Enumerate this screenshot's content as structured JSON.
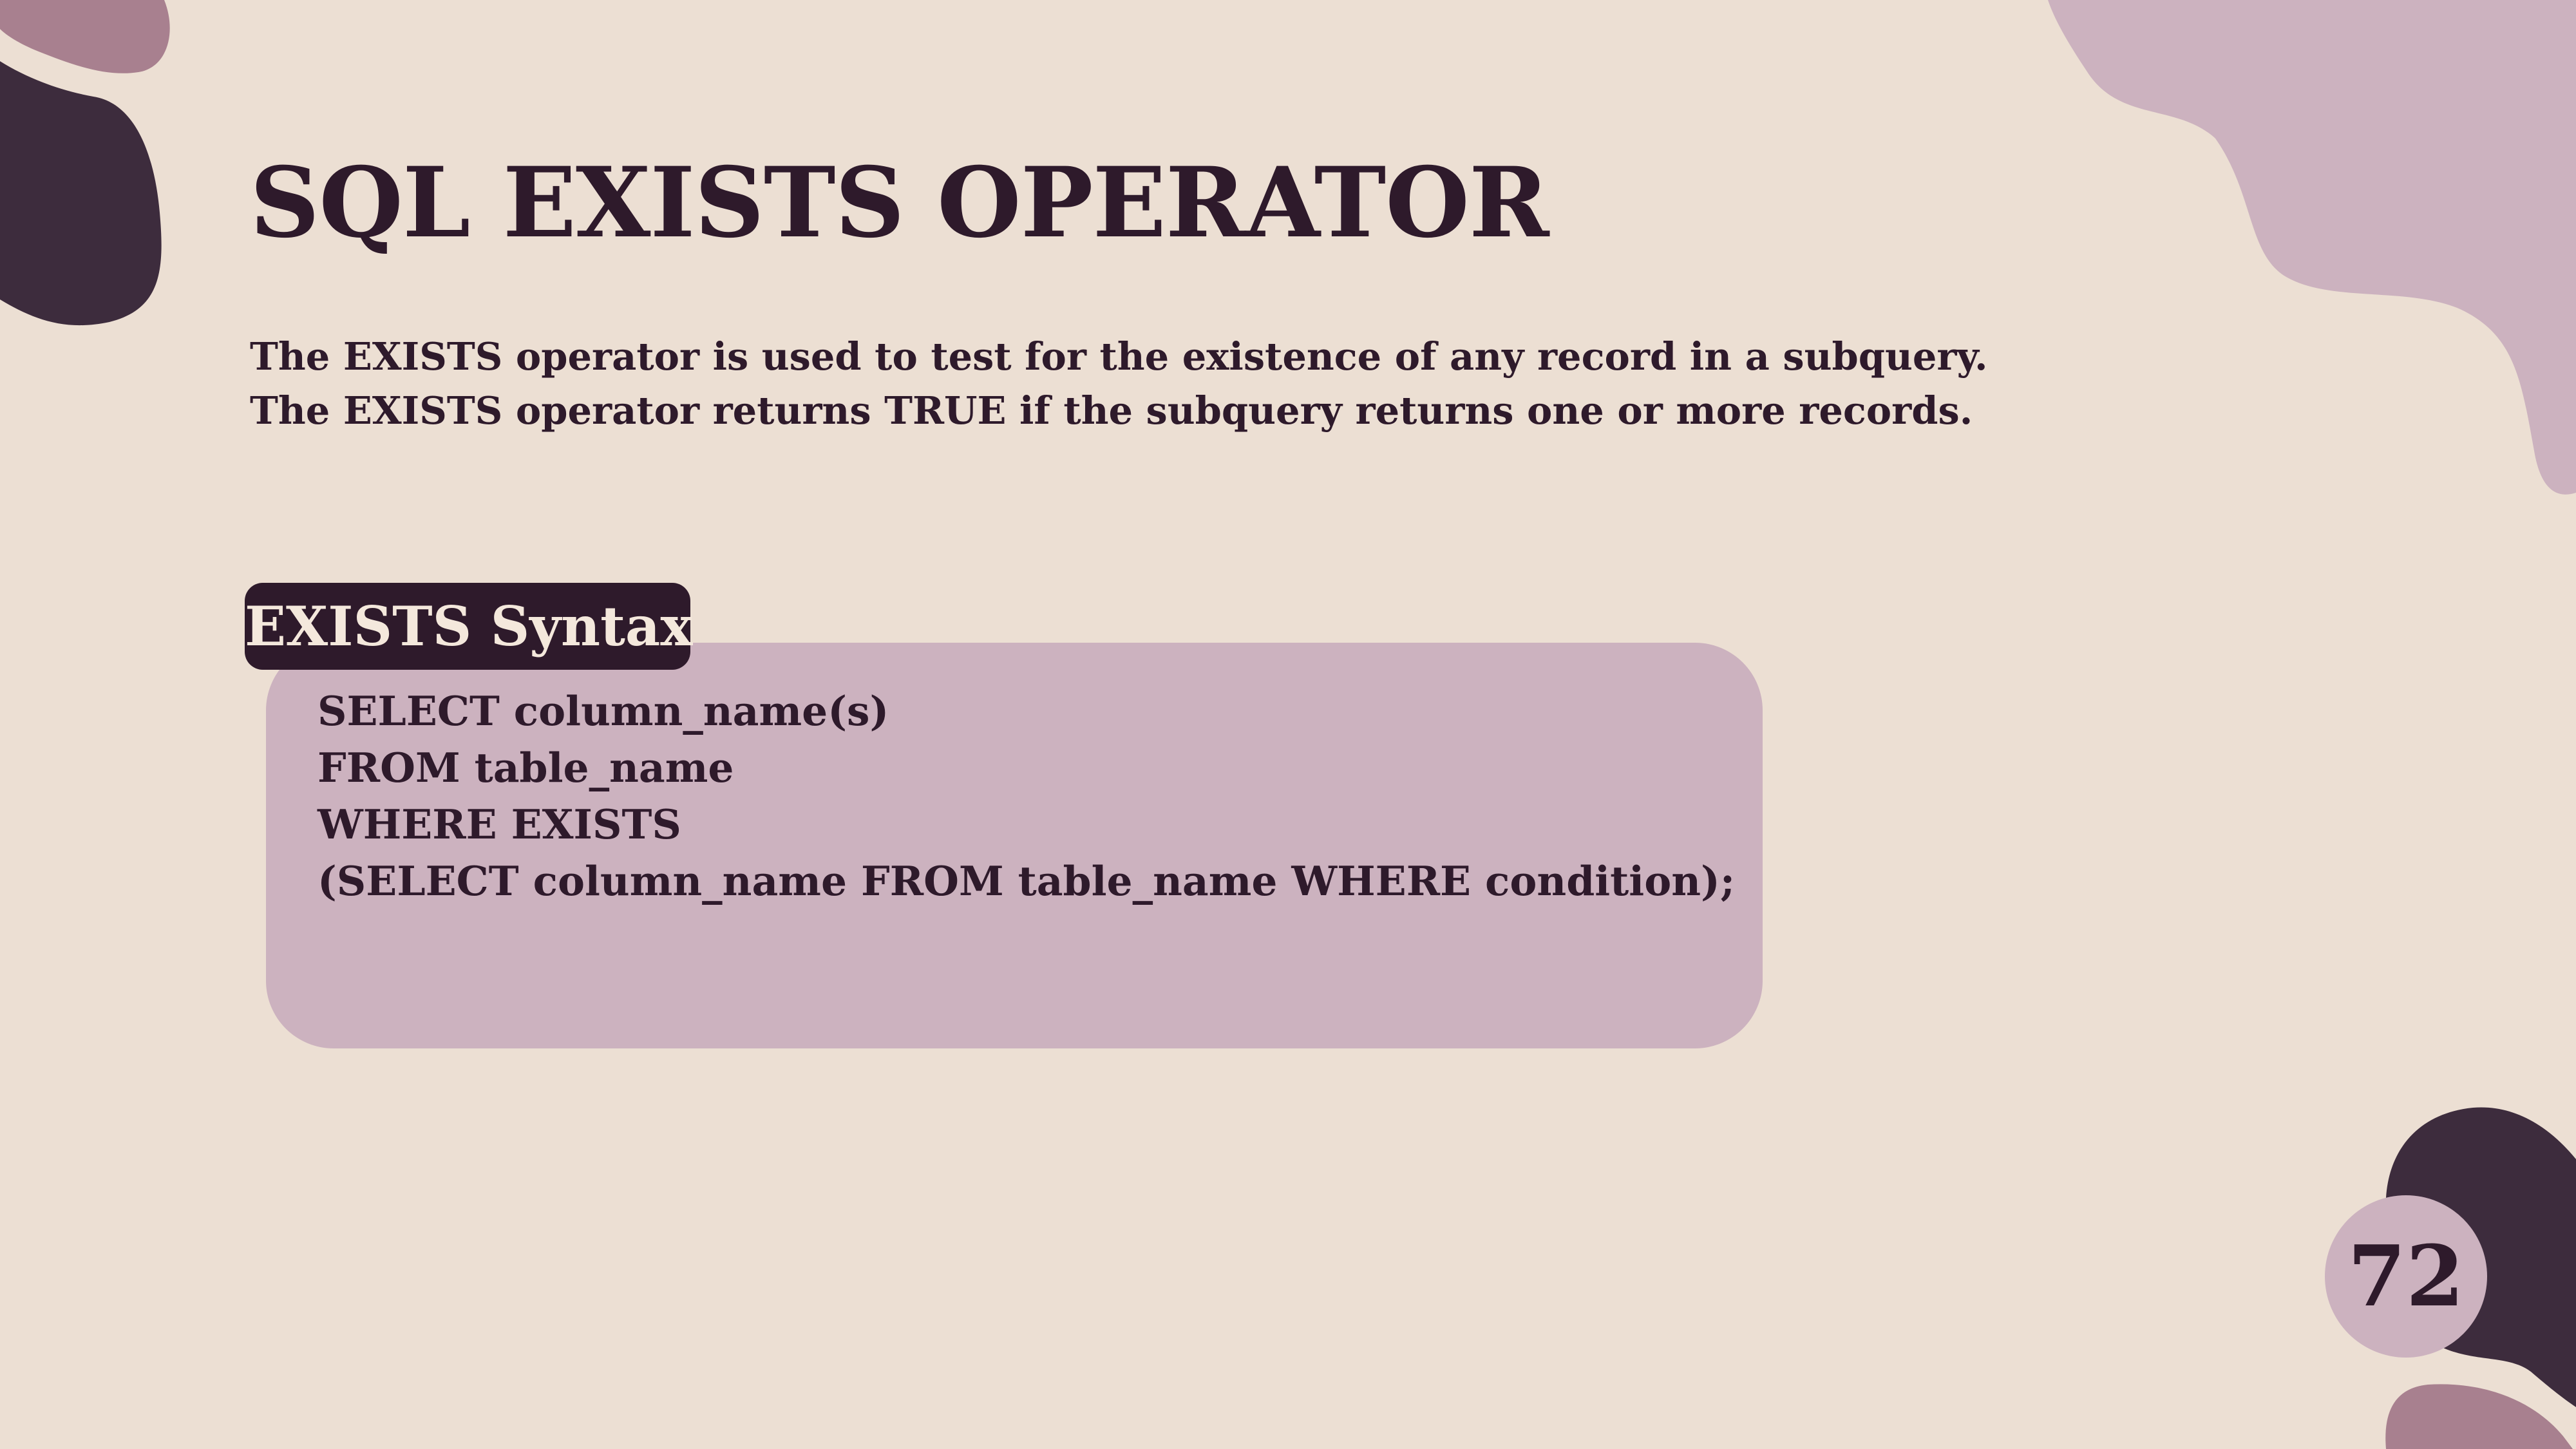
{
  "slide": {
    "title": "SQL EXISTS OPERATOR",
    "description_lines": [
      "The EXISTS operator is used to test for the existence of any record in a subquery.",
      "The EXISTS operator returns TRUE if the subquery returns one or more records."
    ],
    "syntax_label": "EXISTS Syntax",
    "code_lines": [
      "SELECT column_name(s)",
      "FROM table_name",
      "WHERE EXISTS",
      "(SELECT column_name FROM table_name WHERE condition);"
    ],
    "page_number": "72"
  },
  "colors": {
    "background": "#ecdfd3",
    "dark_plum": "#3d2c3d",
    "text": "#2e1a2b",
    "light_mauve": "#ccb2bf",
    "mid_mauve": "#a8808f"
  }
}
